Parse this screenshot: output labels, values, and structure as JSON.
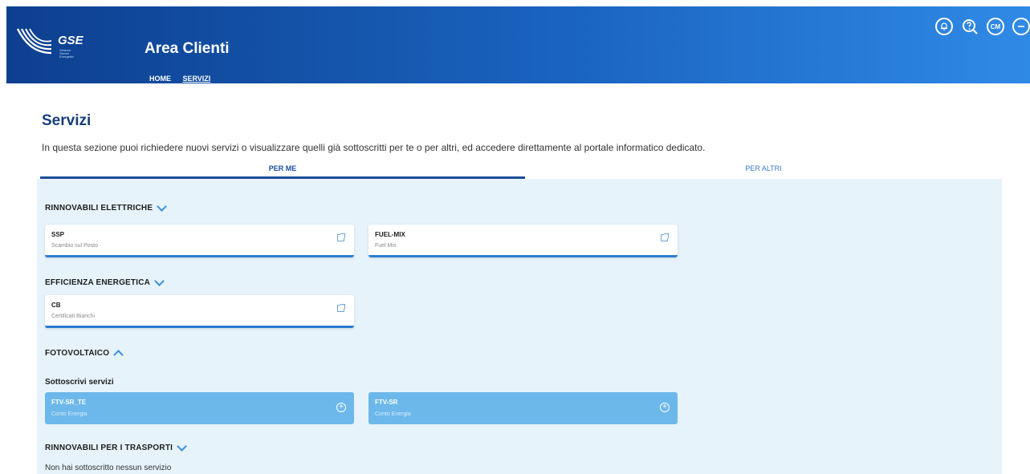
{
  "header": {
    "logo_text": "GSE",
    "logo_sub": "Gestore Servizi Energetici",
    "app_title": "Area Clienti",
    "nav": [
      {
        "label": "HOME"
      },
      {
        "label": "SERVIZI"
      }
    ],
    "icons": [
      "notifications-icon",
      "help-icon",
      "user-initials-icon",
      "logout-icon"
    ],
    "user_initials": "CM"
  },
  "page": {
    "title": "Servizi",
    "intro": "In questa sezione puoi richiedere nuovi servizi o visualizzare quelli già sottoscritti per te o per altri, ed accedere direttamente al portale informatico dedicato."
  },
  "tabs": [
    {
      "label": "PER ME",
      "active": true
    },
    {
      "label": "PER ALTRI",
      "active": false
    }
  ],
  "sections": {
    "rinnovabili_elettriche": {
      "title": "RINNOVABILI ELETTRICHE",
      "cards": [
        {
          "code": "SSP",
          "desc": "Scambio sul Posto"
        },
        {
          "code": "FUEL-MIX",
          "desc": "Fuel Mix"
        }
      ]
    },
    "efficienza_energetica": {
      "title": "EFFICIENZA ENERGETICA",
      "cards": [
        {
          "code": "CB",
          "desc": "Certificati Bianchi"
        }
      ]
    },
    "fotovoltaico": {
      "title": "FOTOVOLTAICO",
      "subscribe_title": "Sottoscrivi servizi",
      "cards": [
        {
          "code": "FTV-SR_TE",
          "desc": "Conto Energia"
        },
        {
          "code": "FTV-SR",
          "desc": "Conto Energia"
        }
      ]
    },
    "rinnovabili_trasporti": {
      "title": "RINNOVABILI PER I TRASPORTI",
      "empty_text": "Non hai sottoscritto nessun servizio"
    }
  },
  "colors": {
    "header_start": "#0d3f8f",
    "header_end": "#2f8ae6",
    "content_bg": "#e6f3fb",
    "accent": "#2e7dd1",
    "subscribe_card": "#6cb8ea"
  }
}
